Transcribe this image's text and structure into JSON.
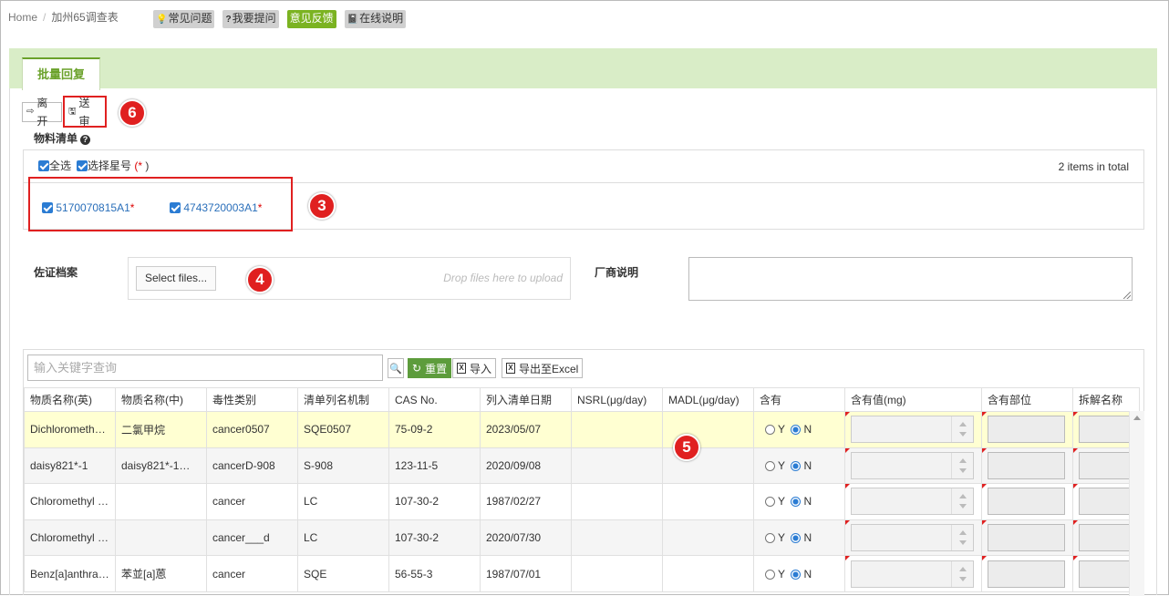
{
  "breadcrumb": {
    "home": "Home",
    "separator": "/",
    "current": "加州65调查表"
  },
  "top_buttons": [
    {
      "label": "常见问题",
      "icon": "bulb-icon",
      "style": "gray"
    },
    {
      "label": "我要提问",
      "icon": "question-icon",
      "style": "gray"
    },
    {
      "label": "意见反馈",
      "icon": "",
      "style": "green"
    },
    {
      "label": "在线说明",
      "icon": "book-icon",
      "style": "gray"
    }
  ],
  "tab": {
    "label": "批量回复"
  },
  "toolbar": {
    "leave_label": "离开",
    "submit_label": "送审"
  },
  "annotations": {
    "submit": "6",
    "items": "3",
    "upload": "4",
    "table": "5"
  },
  "material_list": {
    "title": "物料清单",
    "select_all": "全选",
    "select_star": "选择星号",
    "star_paren_open": "(",
    "star": "*",
    "star_paren_close": ")",
    "total": "2 items in total",
    "items": [
      {
        "code": "5170070815A1",
        "star": "*"
      },
      {
        "code": "4743720003A1",
        "star": "*"
      }
    ]
  },
  "evidence": {
    "label": "佐证档案",
    "select_files": "Select files...",
    "drop_hint": "Drop files here to upload"
  },
  "vendor_note": {
    "label": "厂商说明"
  },
  "grid": {
    "search_placeholder": "输入关键字查询",
    "reset_label": "重置",
    "import_label": "导入",
    "export_label": "导出至Excel",
    "columns": [
      "物质名称(英)",
      "物质名称(中)",
      "毒性类别",
      "清单列名机制",
      "CAS No.",
      "列入清单日期",
      "NSRL(μg/day)",
      "MADL(μg/day)",
      "含有",
      "含有值(mg)",
      "含有部位",
      "拆解名称"
    ],
    "radio_y": "Y",
    "radio_n": "N",
    "rows": [
      {
        "name_en": "Dichlorometh…",
        "name_cn": "二氯甲烷",
        "toxicity": "cancer0507",
        "mechanism": "SQE0507",
        "cas": "75-09-2",
        "date": "2023/05/07",
        "nsrl": "",
        "madl": ""
      },
      {
        "name_en": "daisy821*-1",
        "name_cn": "daisy821*-1…",
        "toxicity": "cancerD-908",
        "mechanism": "S-908",
        "cas": "123-11-5",
        "date": "2020/09/08",
        "nsrl": "",
        "madl": ""
      },
      {
        "name_en": "Chloromethyl …",
        "name_cn": "",
        "toxicity": "cancer",
        "mechanism": "LC",
        "cas": "107-30-2",
        "date": "1987/02/27",
        "nsrl": "",
        "madl": ""
      },
      {
        "name_en": "Chloromethyl …",
        "name_cn": "",
        "toxicity": "cancer___d",
        "mechanism": "LC",
        "cas": "107-30-2",
        "date": "2020/07/30",
        "nsrl": "",
        "madl": ""
      },
      {
        "name_en": "Benz[a]anthra…",
        "name_cn": "苯並[a]蒽",
        "toxicity": "cancer",
        "mechanism": "SQE",
        "cas": "56-55-3",
        "date": "1987/07/01",
        "nsrl": "",
        "madl": ""
      }
    ]
  },
  "colors": {
    "accent_green": "#7bb321",
    "band_green": "#d9edc7",
    "highlight_row": "#ffffd2",
    "annotation_red": "#e02020",
    "link_blue": "#2a6fba"
  }
}
